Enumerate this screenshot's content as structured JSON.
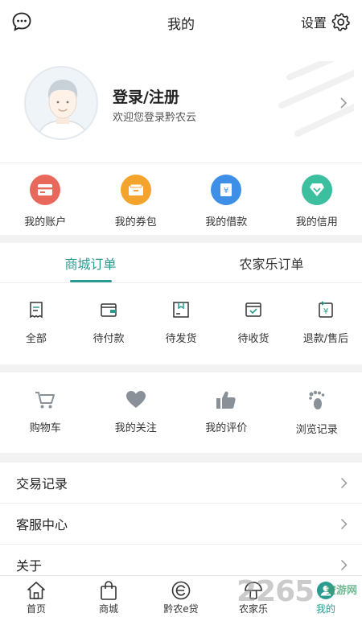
{
  "header": {
    "title": "我的",
    "settings_label": "设置",
    "left_icon": "chat-bubble-icon",
    "right_icon": "gear-icon"
  },
  "profile": {
    "login_label": "登录/注册",
    "welcome_text": "欢迎您登录黔农云"
  },
  "wallet": {
    "items": [
      {
        "label": "我的账户",
        "icon": "card-icon",
        "color": "#e8685c"
      },
      {
        "label": "我的券包",
        "icon": "coupon-icon",
        "color": "#f4a42c"
      },
      {
        "label": "我的借款",
        "icon": "loan-icon",
        "color": "#3e8fe8"
      },
      {
        "label": "我的信用",
        "icon": "diamond-icon",
        "color": "#3bbf9f"
      }
    ]
  },
  "orders": {
    "tabs": [
      {
        "label": "商城订单",
        "active": true
      },
      {
        "label": "农家乐订单",
        "active": false
      }
    ],
    "items": [
      {
        "label": "全部",
        "icon": "all-orders-icon"
      },
      {
        "label": "待付款",
        "icon": "wallet-icon"
      },
      {
        "label": "待发货",
        "icon": "package-icon"
      },
      {
        "label": "待收货",
        "icon": "delivery-icon"
      },
      {
        "label": "退款/售后",
        "icon": "refund-icon"
      }
    ]
  },
  "favorites": {
    "items": [
      {
        "label": "购物车",
        "icon": "cart-icon"
      },
      {
        "label": "我的关注",
        "icon": "heart-icon"
      },
      {
        "label": "我的评价",
        "icon": "thumbs-up-icon"
      },
      {
        "label": "浏览记录",
        "icon": "footprint-icon"
      }
    ]
  },
  "menu": {
    "items": [
      {
        "label": "交易记录"
      },
      {
        "label": "客服中心"
      },
      {
        "label": "关于"
      }
    ]
  },
  "tabbar": {
    "items": [
      {
        "label": "首页",
        "icon": "home-icon",
        "active": false
      },
      {
        "label": "商城",
        "icon": "shopping-bag-icon",
        "active": false
      },
      {
        "label": "黔农e贷",
        "icon": "loan-e-icon",
        "active": false
      },
      {
        "label": "农家乐",
        "icon": "mushroom-icon",
        "active": false
      },
      {
        "label": "我的",
        "icon": "profile-icon",
        "active": true
      }
    ]
  },
  "watermark": {
    "number": "2265",
    "text": "安游网"
  },
  "colors": {
    "accent": "#2a9b90",
    "icon_gray": "#8a9097"
  }
}
